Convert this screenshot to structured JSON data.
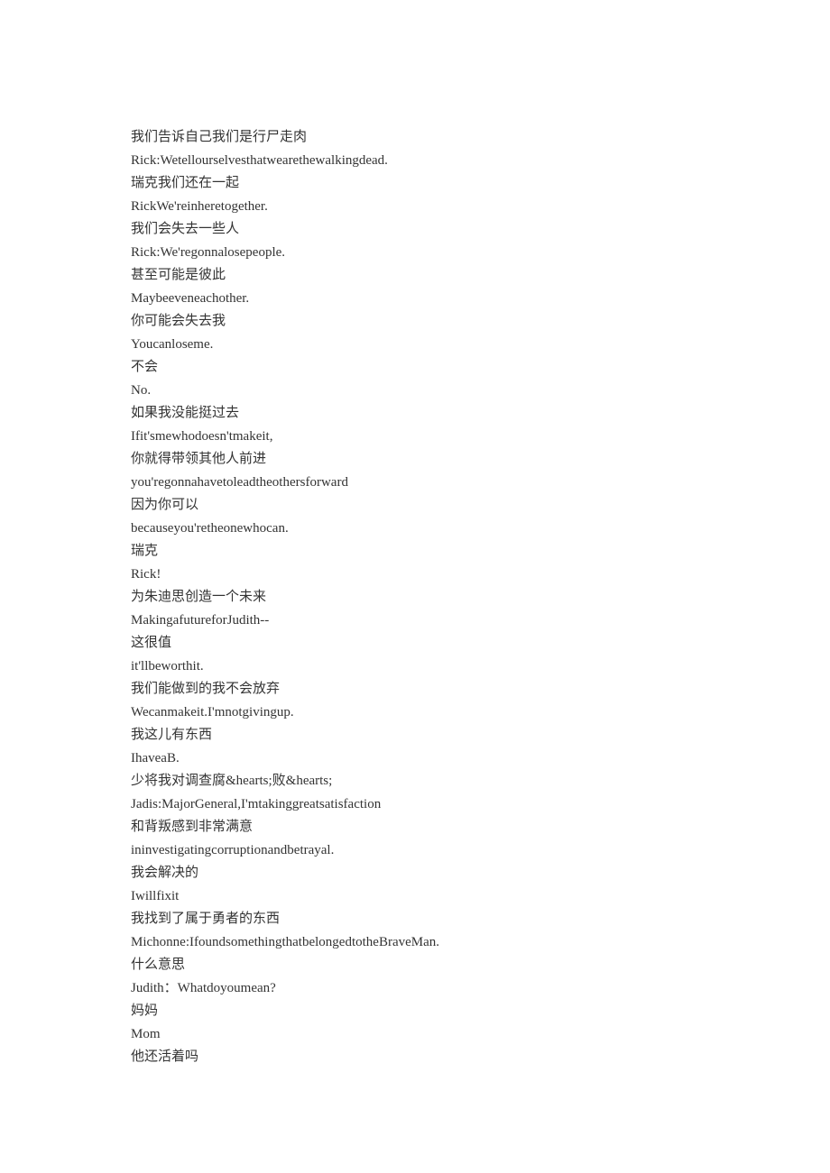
{
  "lines": [
    "我们告诉自己我们是行尸走肉",
    "Rick:Wetellourselvesthatwearethewalkingdead.",
    "瑞克我们还在一起",
    "RickWe'reinheretogether.",
    "我们会失去一些人",
    "Rick:We'regonnalosepeople.",
    "甚至可能是彼此",
    "Maybeeveneachother.",
    "你可能会失去我",
    "Youcanloseme.",
    "不会",
    "No.",
    "如果我没能挺过去",
    "Ifit'smewhodoesn'tmakeit,",
    "你就得带领其他人前进",
    "you'regonnahavetoleadtheothersforward",
    "因为你可以",
    "becauseyou'retheonewhocan.",
    "瑞克",
    "Rick!",
    "为朱迪思创造一个未来",
    "MakingafutureforJudith--",
    "这很值",
    "it'llbeworthit.",
    "我们能做到的我不会放弃",
    "Wecanmakeit.I'mnotgivingup.",
    "我这儿有东西",
    "IhaveaB.",
    "少将我对调查腐&hearts;败&hearts;",
    "Jadis:MajorGeneral,I'mtakinggreatsatisfaction",
    "和背叛感到非常满意",
    "ininvestigatingcorruptionandbetrayal.",
    "我会解决的",
    "Iwillfixit",
    "我找到了属于勇者的东西",
    "Michonne:IfoundsomethingthatbelongedtotheBraveMan.",
    "什么意思",
    "Judith：Whatdoyoumean?",
    "妈妈",
    "Mom",
    "他还活着吗"
  ]
}
